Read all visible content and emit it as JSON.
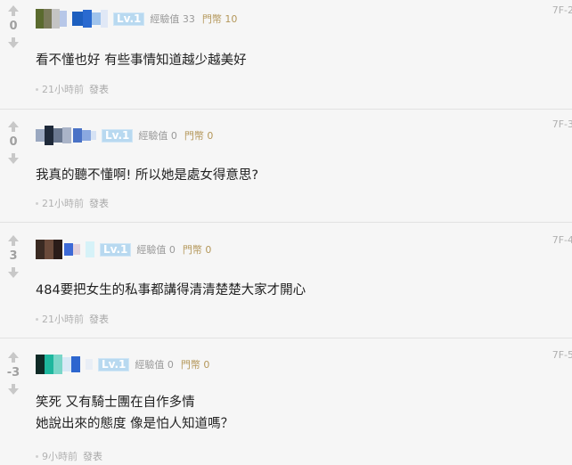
{
  "comments": [
    {
      "score": "0",
      "level": "Lv.1",
      "exp_label": "經驗值 33",
      "coin_label": "門幣 10",
      "floor": "7F-2",
      "lines": [
        "看不懂也好 有些事情知道越少越美好"
      ],
      "time": "21小時前",
      "reply_label": "發表"
    },
    {
      "score": "0",
      "level": "Lv.1",
      "exp_label": "經驗值 0",
      "coin_label": "門幣 0",
      "floor": "7F-3",
      "lines": [
        "我真的聽不懂啊! 所以她是處女得意思?"
      ],
      "time": "21小時前",
      "reply_label": "發表"
    },
    {
      "score": "3",
      "level": "Lv.1",
      "exp_label": "經驗值 0",
      "coin_label": "門幣 0",
      "floor": "7F-4",
      "lines": [
        "484要把女生的私事都講得清清楚楚大家才開心"
      ],
      "time": "21小時前",
      "reply_label": "發表"
    },
    {
      "score": "-3",
      "level": "Lv.1",
      "exp_label": "經驗值 0",
      "coin_label": "門幣 0",
      "floor": "7F-5",
      "lines": [
        "笑死 又有騎士團在自作多情",
        "她說出來的態度 像是怕人知道嗎？"
      ],
      "time": "9小時前",
      "reply_label": "發表"
    }
  ],
  "icons": {
    "upvote": "arrow-up-icon",
    "downvote": "arrow-down-icon"
  },
  "colors": {
    "level_badge": "#b8d9f0",
    "coin_text": "#b4975a",
    "vote_arrow": "#c8c8c8"
  }
}
